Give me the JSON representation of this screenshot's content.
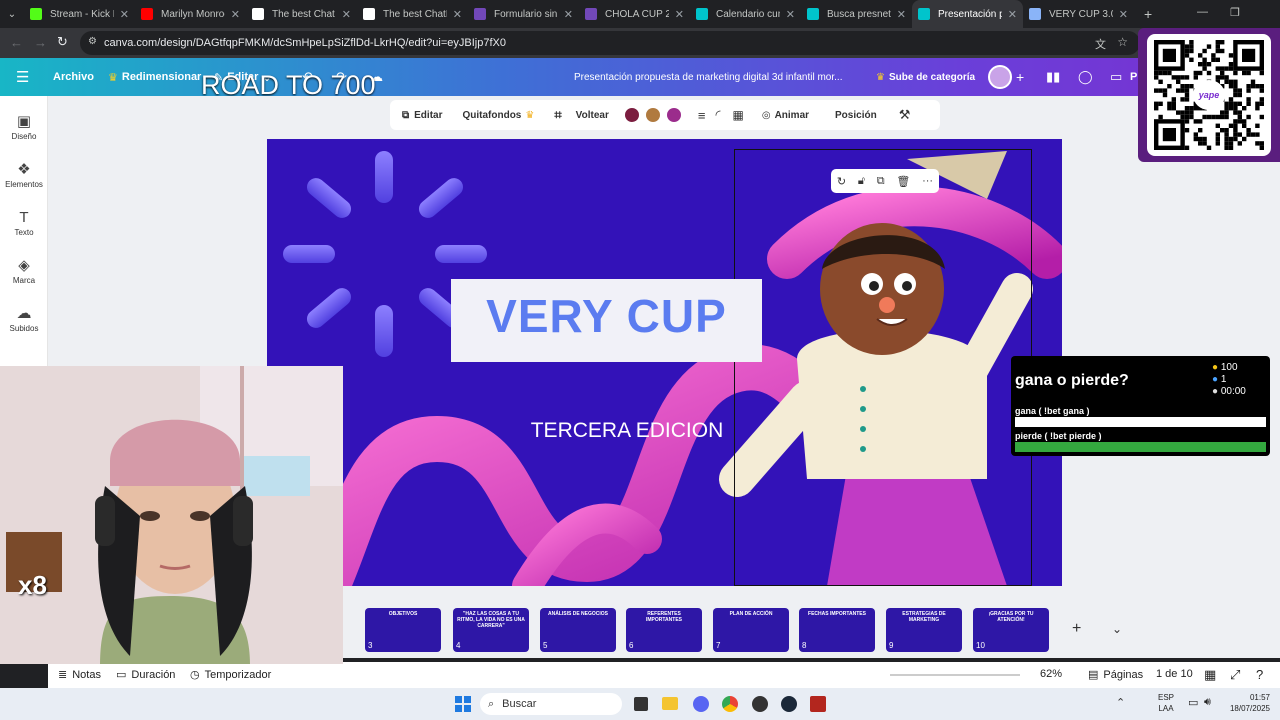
{
  "browser": {
    "tabs": [
      {
        "title": "Stream - Kick Da",
        "color": "#53fc18",
        "active": false
      },
      {
        "title": "Marilyn Monroe:",
        "color": "#ff0000",
        "active": false
      },
      {
        "title": "The best Chat",
        "color": "#ffffff",
        "active": false
      },
      {
        "title": "The best ChatBot",
        "color": "#ffffff",
        "active": false
      },
      {
        "title": "Formulario sin tít",
        "color": "#7248b9",
        "active": false
      },
      {
        "title": "CHOLA CUP 2.0 -",
        "color": "#7248b9",
        "active": false
      },
      {
        "title": "Calendario cumpl",
        "color": "#00c4cc",
        "active": false
      },
      {
        "title": "Busca presnetaci",
        "color": "#00c4cc",
        "active": false
      },
      {
        "title": "Presentación prop",
        "color": "#00c4cc",
        "active": true
      },
      {
        "title": "VERY CUP 3.0 Re",
        "color": "#8ab4f8",
        "active": false
      }
    ],
    "url": "canva.com/design/DAGtfqpFMKM/dcSmHpeLpSiZflDd-LkrHQ/edit?ui=eyJBIjp7fX0"
  },
  "canva_header": {
    "archivo": "Archivo",
    "redimensionar": "Redimensionar",
    "editar": "Editar",
    "doc_title": "Presentación propuesta de marketing digital 3d infantil mor...",
    "upgrade": "Sube de categoría",
    "share": "P"
  },
  "overlay_title": "ROAD TO 700",
  "sidebar": {
    "items": [
      {
        "label": "Diseño",
        "icon": "layout-icon"
      },
      {
        "label": "Elementos",
        "icon": "shapes-icon"
      },
      {
        "label": "Texto",
        "icon": "text-icon"
      },
      {
        "label": "Marca",
        "icon": "brand-icon"
      },
      {
        "label": "Subidos",
        "icon": "cloud-upload-icon"
      }
    ]
  },
  "toolbar": {
    "editar": "Editar",
    "quitafondos": "Quitafondos",
    "voltear": "Voltear",
    "animar": "Animar",
    "posicion": "Posición",
    "colors": [
      "#7b1d3f",
      "#b07a3f",
      "#9b2c8c"
    ]
  },
  "slide": {
    "title": "VERY CUP",
    "subtitle": "TERCERA EDICION"
  },
  "thumbnails": [
    {
      "num": "",
      "label": ""
    },
    {
      "num": "3",
      "label": "OBJETIVOS"
    },
    {
      "num": "4",
      "label": "\"HAZ LAS COSAS A TU RITMO, LA VIDA NO ES UNA CARRERA\""
    },
    {
      "num": "5",
      "label": "ANÁLISIS DE NEGOCIOS"
    },
    {
      "num": "6",
      "label": "REFERENTES IMPORTANTES"
    },
    {
      "num": "7",
      "label": "PLAN DE ACCIÓN"
    },
    {
      "num": "8",
      "label": "FECHAS IMPORTANTES"
    },
    {
      "num": "9",
      "label": "ESTRATEGIAS DE MARKETING"
    },
    {
      "num": "10",
      "label": "¡GRACIAS POR TU ATENCIÓN!"
    }
  ],
  "statusbar": {
    "notas": "Notas",
    "duracion": "Duración",
    "temporizador": "Temporizador",
    "zoom": "62%",
    "paginas": "Páginas",
    "page_indicator": "1 de 10"
  },
  "poll": {
    "question": "gana o pierde?",
    "coins": "100",
    "users": "1",
    "timer": "00:00",
    "option1": "gana ( !bet gana )",
    "option2": "pierde ( !bet pierde )",
    "option1_fraction": 0,
    "option2_fraction": 1
  },
  "webcam": {
    "badge": "x8"
  },
  "taskbar": {
    "search": "Buscar",
    "lang": "ESP",
    "lang2": "LAA",
    "time": "01:57",
    "date": "18/07/2025"
  },
  "qr": {
    "brand": "yape"
  }
}
